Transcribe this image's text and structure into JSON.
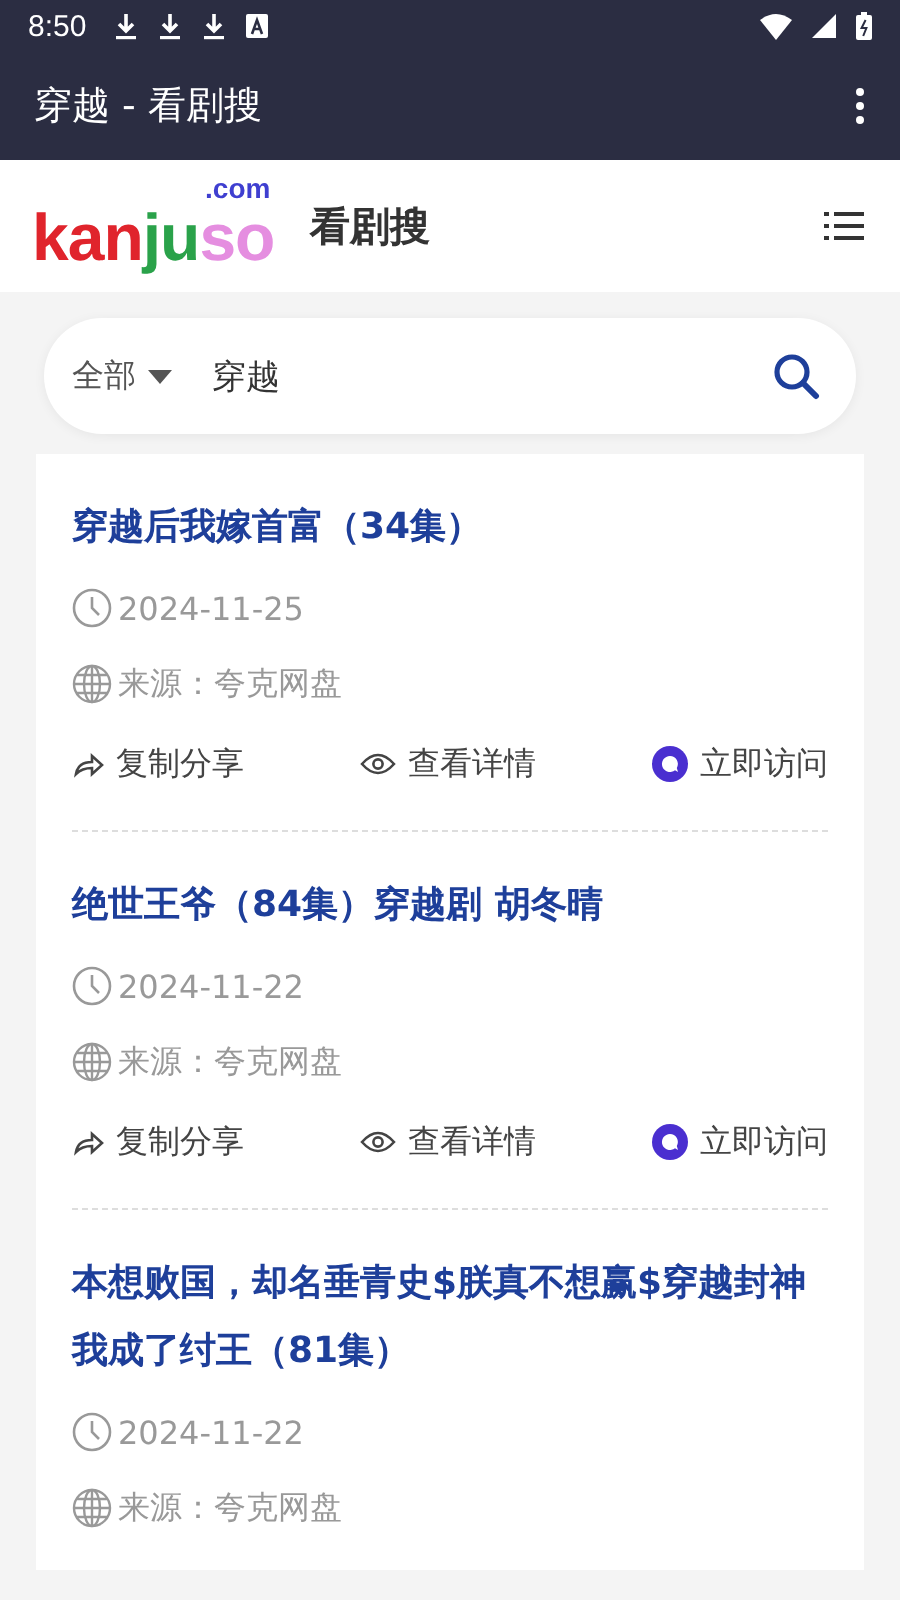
{
  "status_bar": {
    "time": "8:50"
  },
  "app_bar": {
    "title": "穿越 - 看剧搜"
  },
  "header": {
    "logo": [
      {
        "text": "kan",
        "color": "#e0242c"
      },
      {
        "text": "ju",
        "color": "#2aa24a"
      },
      {
        "text": "so",
        "color": "#e58ee0"
      }
    ],
    "logo_suffix": ".com",
    "site_name": "看剧搜"
  },
  "search": {
    "scope": "全部",
    "value": "穿越"
  },
  "results": [
    {
      "title": "穿越后我嫁首富（34集）",
      "date": "2024-11-25",
      "source": "来源：夸克网盘",
      "actions": [
        "复制分享",
        "查看详情",
        "立即访问"
      ]
    },
    {
      "title": "绝世王爷（84集）穿越剧 胡冬晴",
      "date": "2024-11-22",
      "source": "来源：夸克网盘",
      "actions": [
        "复制分享",
        "查看详情",
        "立即访问"
      ]
    },
    {
      "title": "本想败国，却名垂青史$朕真不想赢$穿越封神我成了纣王（81集）",
      "date": "2024-11-22",
      "source": "来源：夸克网盘"
    }
  ]
}
